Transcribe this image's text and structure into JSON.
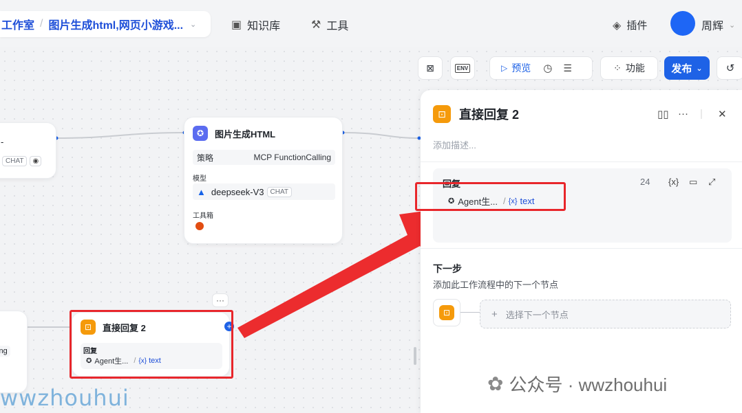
{
  "header": {
    "breadcrumb_root": "工作室",
    "breadcrumb_sep": "/",
    "breadcrumb_project": "图片生成html,网页小游戏...",
    "nav_knowledge": "知识库",
    "nav_tools": "工具",
    "plugins": "插件",
    "user_name": "周辉"
  },
  "toolbar": {
    "env_label": "ENV",
    "preview": "预览",
    "features": "功能",
    "publish": "发布"
  },
  "nodes": {
    "left_top": {
      "text": "-",
      "tag": "CHAT"
    },
    "agent": {
      "title": "图片生成HTML",
      "strategy_label": "策略",
      "strategy_value": "MCP FunctionCalling",
      "model_label": "模型",
      "model_value": "deepseek-V3",
      "model_tag": "CHAT",
      "toolbox_label": "工具箱"
    },
    "left_bottom": {
      "text": "alling"
    },
    "reply2": {
      "title": "直接回复 2",
      "field_label": "回复",
      "ref_source": "Agent生...",
      "ref_var": "text",
      "more": "···"
    }
  },
  "panel": {
    "title": "直接回复 2",
    "description_placeholder": "添加描述...",
    "reply_label": "回复",
    "char_count": "24",
    "var_icon_label": "{x}",
    "ref_source": "Agent生...",
    "ref_var": "text",
    "next_title": "下一步",
    "next_subtitle": "添加此工作流程中的下一个节点",
    "next_select": "选择下一个节点"
  },
  "watermark": {
    "left": "wwzhouhui",
    "right": "公众号 · wwzhouhui"
  },
  "colors": {
    "accent": "#1e62e6",
    "highlight": "#e8262b",
    "reply_node": "#f59a0b",
    "agent_node": "#5b6cf0"
  }
}
